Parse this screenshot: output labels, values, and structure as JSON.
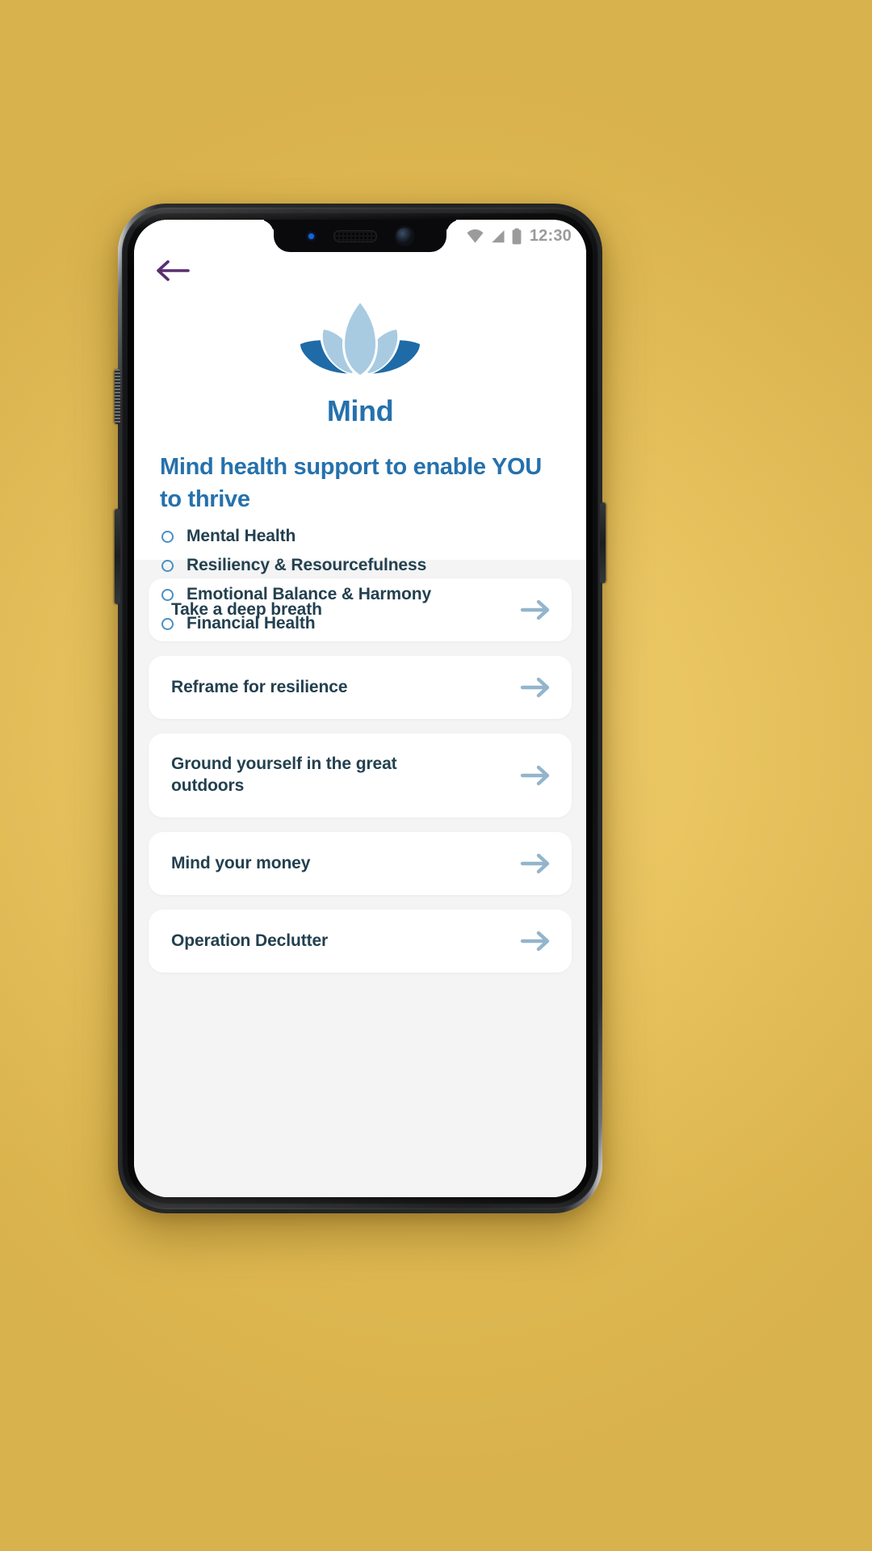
{
  "background": {
    "color": "#e9c45f"
  },
  "device": {
    "frame_color": "#1a1b1d",
    "notch": {
      "led_name": "notification-led",
      "speaker_name": "earpiece-speaker",
      "camera_name": "front-camera"
    },
    "buttons": {
      "alert_slider": "alert-slider",
      "volume": "volume-button",
      "power": "power-button"
    }
  },
  "statusbar": {
    "wifi_icon": "wifi-icon",
    "signal_icon": "cellular-signal-icon",
    "battery_icon": "battery-icon",
    "time": "12:30",
    "icon_color": "#9b9b9b"
  },
  "navigation": {
    "back_label": "Back",
    "back_icon": "arrow-left-icon",
    "back_color": "#5b2d71"
  },
  "hero": {
    "logo_icon": "lotus-flower-logo",
    "logo_colors": {
      "petal_light": "#a8cbe2",
      "petal_dark": "#1f6ba8"
    },
    "brand_title": "Mind",
    "brand_color": "#2571ad",
    "heading": "Mind health support to enable YOU to thrive",
    "bullets": [
      {
        "label": "Mental Health"
      },
      {
        "label": "Resiliency & Resourcefulness"
      },
      {
        "label": "Emotional Balance & Harmony"
      },
      {
        "label": "Financial Health"
      }
    ],
    "bullet_marker_color": "#4b8fc4",
    "bullet_text_color": "#23404f"
  },
  "cards": {
    "arrow_icon": "arrow-right-icon",
    "arrow_color": "#93b5cc",
    "items": [
      {
        "title": "Take a deep breath"
      },
      {
        "title": "Reframe for resilience"
      },
      {
        "title": "Ground yourself in the great outdoors"
      },
      {
        "title": "Mind your money"
      },
      {
        "title": "Operation Declutter"
      }
    ]
  }
}
